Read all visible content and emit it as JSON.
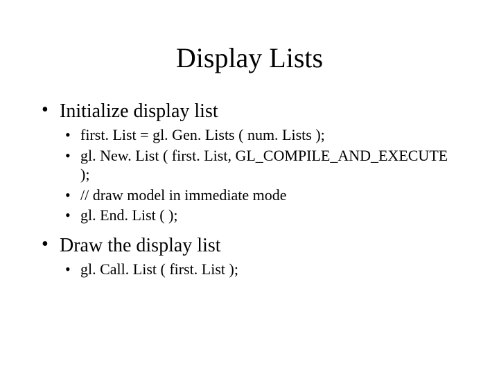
{
  "title": "Display Lists",
  "sections": [
    {
      "heading": "Initialize display list",
      "items": [
        "first. List = gl. Gen. Lists ( num. Lists );",
        "gl. New. List ( first. List, GL_COMPILE_AND_EXECUTE );",
        "// draw model in immediate mode",
        "gl. End. List ( );"
      ]
    },
    {
      "heading": "Draw the display list",
      "items": [
        "gl. Call. List ( first. List );"
      ]
    }
  ]
}
